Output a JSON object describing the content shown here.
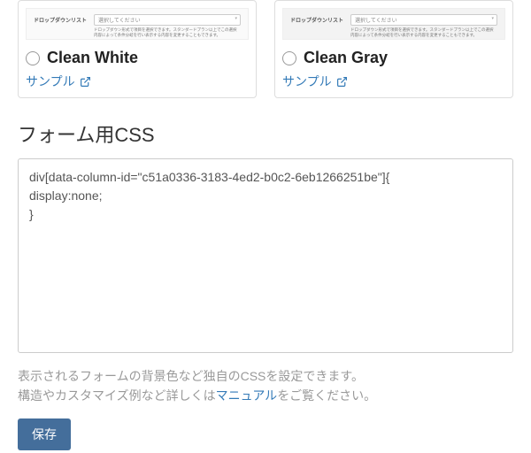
{
  "preview": {
    "dropdown_label": "ドロップダウンリスト",
    "select_placeholder": "選択してください",
    "desc_text": "ドロップダウン形式で項目を選択できます。スタンダードプラン以上でこの選択内容によって条件分岐を行い表示する内容を変更することもできます。"
  },
  "themes": [
    {
      "title": "Clean White",
      "sample": "サンプル"
    },
    {
      "title": "Clean Gray",
      "sample": "サンプル"
    }
  ],
  "css_section": {
    "heading": "フォーム用CSS",
    "value": "div[data-column-id=\"c51a0336-3183-4ed2-b0c2-6eb1266251be\"]{\ndisplay:none;\n}"
  },
  "help": {
    "line1": "表示されるフォームの背景色など独自のCSSを設定できます。",
    "line2_before": "構造やカスタマイズ例など詳しくは",
    "line2_link": "マニュアル",
    "line2_after": "をご覧ください。"
  },
  "save_label": "保存"
}
